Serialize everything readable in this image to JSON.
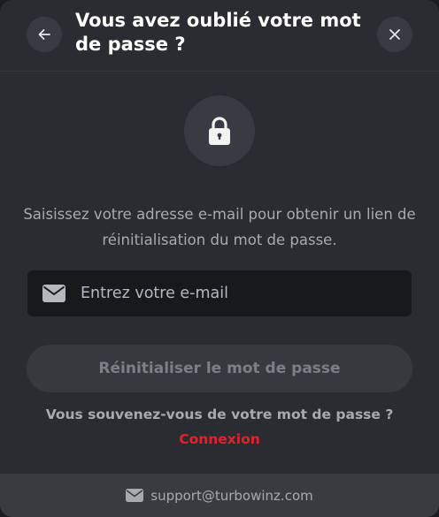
{
  "header": {
    "title": "Vous avez oublié votre mot de passe ?",
    "back_icon": "arrow-left-icon",
    "close_icon": "close-icon"
  },
  "main": {
    "lock_icon": "lock-icon",
    "description": "Saisissez votre adresse e-mail pour obtenir un lien de réinitialisation du mot de passe.",
    "email_field": {
      "icon": "envelope-icon",
      "value": "",
      "placeholder": "Entrez votre e-mail"
    },
    "reset_button_label": "Réinitialiser le mot de passe",
    "remember_text": "Vous souvenez-vous de votre mot de passe ?",
    "login_link_label": "Connexion"
  },
  "footer": {
    "icon": "envelope-icon",
    "support_email": "support@turbowinz.com"
  },
  "colors": {
    "modal_background": "#2b2c32",
    "input_background": "#18191c",
    "link_accent": "#e5212b",
    "button_background": "#38393f",
    "footer_background": "#3a3b41"
  }
}
